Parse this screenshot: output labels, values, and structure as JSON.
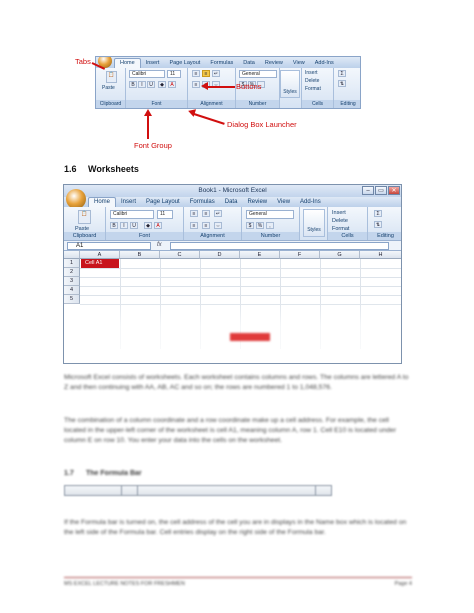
{
  "fig1": {
    "tabs": [
      "Home",
      "Insert",
      "Page Layout",
      "Formulas",
      "Data",
      "Review",
      "View",
      "Add-Ins"
    ],
    "font_name": "Calibri",
    "font_size": "11",
    "number_format": "General",
    "groups": [
      "Clipboard",
      "Font",
      "Alignment",
      "Number",
      "Styles",
      "Cells",
      "Editing"
    ],
    "styles_label": "Styles",
    "cells_buttons": [
      "Insert",
      "Delete",
      "Format"
    ],
    "paste_label": "Paste",
    "annotations": {
      "tabs": "Tabs",
      "buttons": "Buttons",
      "dialog_box_launcher": "Dialog Box Launcher",
      "font_group": "Font Group"
    },
    "annotation_color": "#d10f0f"
  },
  "section": {
    "number": "1.6",
    "title": "Worksheets"
  },
  "excel": {
    "window_title": "Book1 - Microsoft Excel",
    "tabs": [
      "Home",
      "Insert",
      "Page Layout",
      "Formulas",
      "Data",
      "Review",
      "View",
      "Add-Ins"
    ],
    "font_name": "Calibri",
    "font_size": "11",
    "number_format": "General",
    "groups": [
      "Clipboard",
      "Font",
      "Alignment",
      "Number",
      "Styles",
      "Cells",
      "Editing"
    ],
    "styles_label": "Styles",
    "paste_label": "Paste",
    "cells_buttons": [
      "Insert",
      "Delete",
      "Format"
    ],
    "name_box": "A1",
    "fx": "fx",
    "columns": [
      "A",
      "B",
      "C",
      "D",
      "E",
      "F",
      "G",
      "H"
    ],
    "rows": [
      "1",
      "2",
      "3",
      "4",
      "5"
    ],
    "cell_a1": "Cell A1",
    "window_buttons": [
      "–",
      "▭",
      "✕"
    ]
  },
  "body": {
    "p1": "Microsoft Excel consists of worksheets. Each worksheet contains columns and rows. The columns are lettered A to Z and then continuing with AA, AB, AC and so on; the rows are numbered 1 to 1,048,576.",
    "p2": "The combination of a column coordinate and a row coordinate make up a cell address. For example, the cell located in the upper-left corner of the worksheet is cell A1, meaning column A, row 1. Cell E10 is located under column E on row 10. You enter your data into the cells on the worksheet.",
    "sub_number": "1.7",
    "sub_title": "The Formula Bar",
    "p3": "If the Formula bar is turned on, the cell address of the cell you are in displays in the Name box which is located on the left side of the Formula bar. Cell entries display on the right side of the Formula bar.",
    "footer_text": "MS EXCEL LECTURE NOTES FOR FRESHMEN",
    "footer_page": "Page 4"
  }
}
